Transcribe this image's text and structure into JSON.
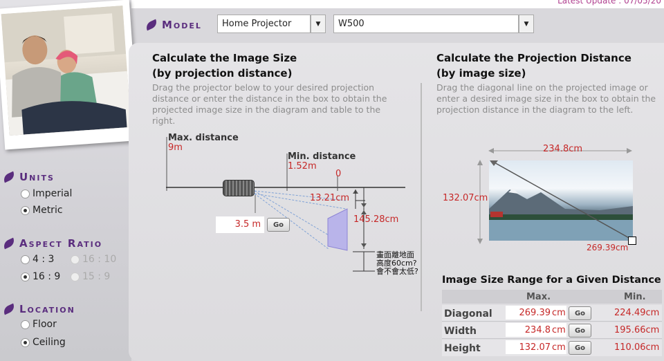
{
  "header": {
    "update_text": "Latest Update : 07/05/20",
    "model_label": "Model",
    "model_select": "Home Projector",
    "submodel_select": "W500"
  },
  "sidebar": {
    "units": {
      "title": "Units",
      "options": [
        {
          "label": "Imperial",
          "selected": false
        },
        {
          "label": "Metric",
          "selected": true
        }
      ]
    },
    "aspect_ratio": {
      "title": "Aspect Ratio",
      "options": [
        {
          "label": "4 : 3",
          "selected": false,
          "enabled": true
        },
        {
          "label": "16 : 10",
          "selected": false,
          "enabled": false
        },
        {
          "label": "16 : 9",
          "selected": true,
          "enabled": true
        },
        {
          "label": "15 : 9",
          "selected": false,
          "enabled": false
        }
      ]
    },
    "location": {
      "title": "Location",
      "options": [
        {
          "label": "Floor",
          "selected": false
        },
        {
          "label": "Ceiling",
          "selected": true
        }
      ]
    }
  },
  "left_panel": {
    "title_line1": "Calculate the Image Size",
    "title_line2": "(by projection distance)",
    "desc": "Drag the projector below to your desired projection distance or enter the distance in the box to obtain the projected image size in the diagram and table to the right.",
    "max_distance_label": "Max. distance",
    "max_distance_value": "9m",
    "min_distance_label": "Min. distance",
    "min_distance_value": "1.52m",
    "zero_label": "0",
    "offset_value": "13.21cm",
    "height_value": "145.28cm",
    "distance_input": "3.5",
    "distance_unit": "m",
    "go_label": "Go",
    "note": "畫面離地面高度60cm?會不會太低?"
  },
  "right_panel": {
    "title_line1": "Calculate the Projection Distance",
    "title_line2": "(by image size)",
    "desc": "Drag the diagonal line on the projected image or enter a desired image size in the box to obtain the projection distance in the diagram to the left.",
    "width_value": "234.8cm",
    "height_value": "132.07cm",
    "diagonal_value": "269.39cm"
  },
  "range_table": {
    "title": "Image Size Range for a Given Distance",
    "col_max": "Max.",
    "col_min": "Min.",
    "go_label": "Go",
    "unit": "cm",
    "rows": [
      {
        "label": "Diagonal",
        "max": "269.39",
        "min": "224.49cm"
      },
      {
        "label": "Width",
        "max": "234.8",
        "min": "195.66cm"
      },
      {
        "label": "Height",
        "max": "132.07",
        "min": "110.06cm"
      }
    ]
  }
}
